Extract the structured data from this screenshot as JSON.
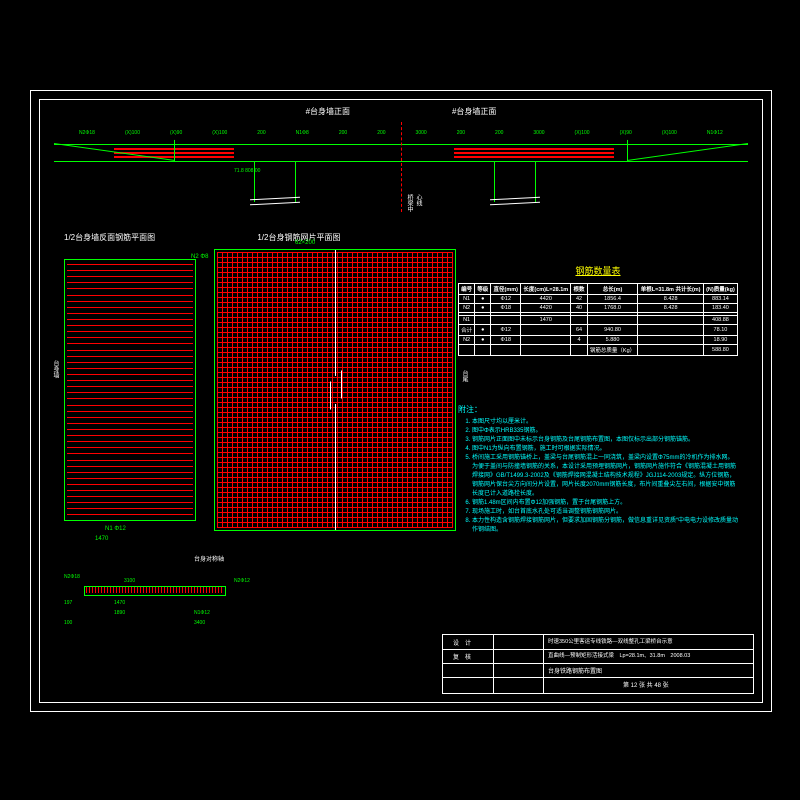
{
  "elev": {
    "title_left": "#台身墙正面",
    "title_right": "#台身墙正面",
    "dims": [
      "N2Φ18",
      "(X)100",
      "(X)90",
      "(X)100",
      "200",
      "N1Φ8",
      "200",
      "200",
      "3000",
      "200",
      "200",
      "3000",
      "(X)100",
      "(X)90",
      "(X)100",
      "N1Φ12"
    ],
    "level": "71.8  808.00",
    "cl": "桥梁中心线"
  },
  "plans": {
    "title_left": "1/2台身墙反面钢筋平面图",
    "title_right": "1/2台身钢筋网片平面图",
    "lbl_n1": "N1 Φ12",
    "lbl_n2": "N2 Φ8",
    "lbl_tb": "台身墙",
    "lbl_tw": "台尾",
    "lbl_sym": "台身对称轴",
    "dim_h1": "1470",
    "dim_grid": "62×200"
  },
  "table": {
    "title": "钢筋数量表",
    "head": [
      "编号",
      "等级",
      "直径(mm)",
      "长度(cm)L=28.1m",
      "根数",
      "总长(m)",
      "单根L=31.8m 共计长(m)",
      "(N)质量(kg)"
    ],
    "rows": [
      [
        "N1",
        "●",
        "Φ12",
        "4420",
        "42",
        "1856.4",
        "8.428",
        "883.14"
      ],
      [
        "N2",
        "●",
        "Φ18",
        "4420",
        "40",
        "1768.0",
        "8.428",
        "183.40"
      ],
      [
        "",
        "",
        "",
        "",
        "",
        "",
        "",
        ""
      ],
      [
        "N1",
        "",
        "",
        "1470",
        "",
        "",
        "",
        "408.88"
      ],
      [
        "合计",
        "●",
        "Φ12",
        "",
        "64",
        "940.80",
        "",
        "78.10"
      ],
      [
        "N2",
        "●",
        "Φ18",
        "",
        "4",
        "5.880",
        "",
        "18.90"
      ],
      [
        "",
        "",
        "",
        "",
        "",
        "钢筋总质量（Kg）",
        "",
        "588.80"
      ]
    ]
  },
  "notes": {
    "hd": "附注：",
    "items": [
      "本图尺寸均以厘米计。",
      "图中Φ表示HRB335钢筋。",
      "钢筋网片正面图中未标示台身钢筋及台尾钢筋布置图，本图仅标示出部分钢筋锚筋。",
      "图中N1为纵向布置钢筋，施工时可根据实际情况。",
      "桥间施工采用钢筋锚桥上，盖梁与台尾钢筋混上一同浇筑，盖梁内设置Φ75mm的冷机作为排水网。为便于盖间与防撞墙钢筋的关系，本设计采用预埋钢筋网片，钢筋网片施作符合《钢筋混凝土用钢筋焊接网》GB/T1499.3-2002及《钢筋焊接网混凝土结构技术规程》JGJ114-2003规定。纵方位钢筋，钢筋网片保台尖方向间分片设置，网片长度2070mm钢筋长度，布片间重叠尖左右间，根据安中钢筋长度已计入道路栓长度。",
      "钢筋1.48m区间内布置Φ12加强钢筋，置于台尾钢筋上方。",
      "现场施工时，如台首底水孔处可适当调整钢筋钢筋网片。",
      "本力性构造含钢筋焊接钢筋网片，但要求加固钢筋分钢筋，做信息重详见资质“中电电力设修改质量动作钢结图。"
    ]
  },
  "sec": {
    "title": "台身对称轴",
    "d1": "N2Φ18",
    "d2": "3100",
    "d3": "1470",
    "d4": "1890",
    "d5": "100",
    "d6": "N1Φ12",
    "d7": "3400",
    "d8": "N2Φ12",
    "d9": "197"
  },
  "tb": {
    "design": "设　计",
    "check": "复　核",
    "project": "时速350公里客运专线铁路—双线整孔工梁桥台示意",
    "sub": "直曲线—预制矩形活接式梁　Lp=28.1m、31.8m　2008.03",
    "drawing": "台身铁路钢筋布置图",
    "sheet": "第 12 张 共 48 张"
  }
}
